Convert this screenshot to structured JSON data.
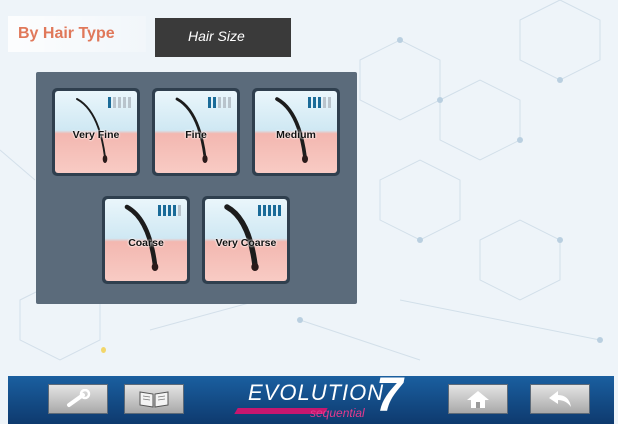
{
  "header": {
    "title": "By Hair Type",
    "hair_size_tab": "Hair Size"
  },
  "hair_types": [
    {
      "label": "Very Fine",
      "level": 1,
      "bars_total": 5
    },
    {
      "label": "Fine",
      "level": 2,
      "bars_total": 5
    },
    {
      "label": "Medium",
      "level": 3,
      "bars_total": 5
    },
    {
      "label": "Coarse",
      "level": 4,
      "bars_total": 5
    },
    {
      "label": "Very Coarse",
      "level": 5,
      "bars_total": 5
    }
  ],
  "footer": {
    "settings_icon": "wrench-icon",
    "manual_icon": "book-icon",
    "logo_text": "EVOLUTION",
    "logo_number": "7",
    "logo_sub": "sequential",
    "home_icon": "home-icon",
    "back_icon": "back-arrow-icon"
  },
  "colors": {
    "title": "#e0785a",
    "panel": "#5b6b7b",
    "footer": "#1a5fa0",
    "bar_on": "#1a6b98"
  }
}
